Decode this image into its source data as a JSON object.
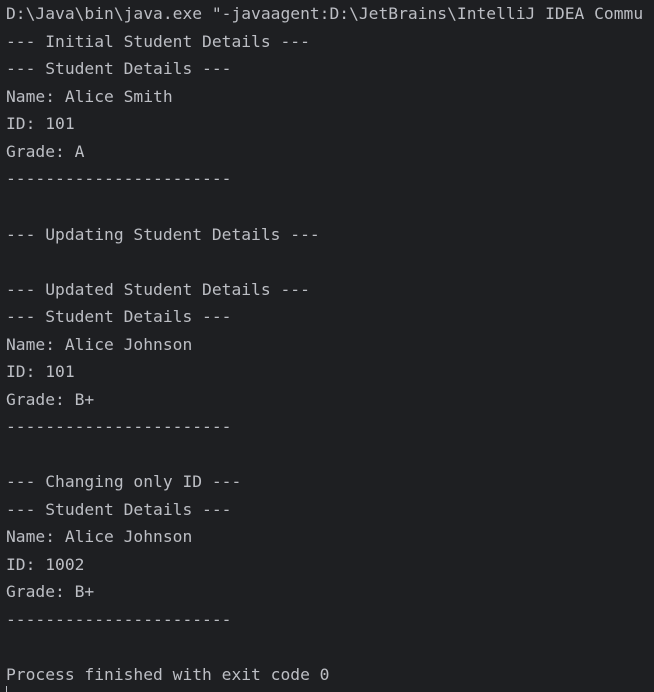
{
  "console": {
    "lines": [
      "D:\\Java\\bin\\java.exe \"-javaagent:D:\\JetBrains\\IntelliJ IDEA Commu",
      "--- Initial Student Details ---",
      "--- Student Details ---",
      "Name: Alice Smith",
      "ID: 101",
      "Grade: A",
      "-----------------------",
      "--- Updating Student Details ---",
      "--- Updated Student Details ---",
      "--- Student Details ---",
      "Name: Alice Johnson",
      "ID: 101",
      "Grade: B+",
      "-----------------------",
      "--- Changing only ID ---",
      "--- Student Details ---",
      "Name: Alice Johnson",
      "ID: 1002",
      "Grade: B+",
      "-----------------------",
      "Process finished with exit code 0"
    ]
  }
}
